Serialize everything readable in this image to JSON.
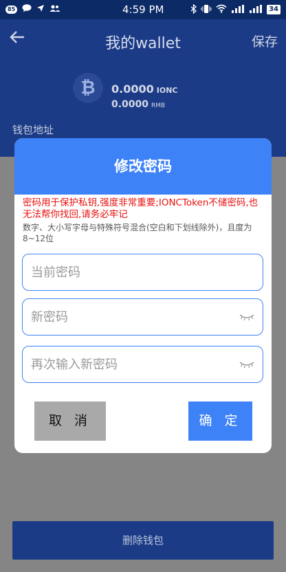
{
  "status_bar": {
    "notif_count": "85",
    "time": "4:59 PM",
    "battery": "34"
  },
  "header": {
    "title": "我的wallet",
    "save_label": "保存"
  },
  "balance": {
    "amount_1": "0.0000",
    "unit_1": "IONC",
    "amount_2": "0.0000",
    "unit_2": "RMB"
  },
  "address_label": "钱包地址",
  "dialog": {
    "title": "修改密码",
    "warning": "密码用于保护私钥,强度非常重要;IONCToken不储密码,也无法帮你找回,请务必牢记",
    "hint": "数字、大小写字母与特殊符号混合(空白和下划线除外)，且度为8~12位",
    "current_password_placeholder": "当前密码",
    "new_password_placeholder": "新密码",
    "confirm_password_placeholder": "再次输入新密码",
    "cancel_label": "取 消",
    "confirm_label": "确 定"
  },
  "delete_label": "删除钱包",
  "icons": {
    "back": "back-arrow-icon",
    "coin": "bitcoin-icon",
    "eye": "eye-closed-icon"
  },
  "colors": {
    "primary": "#3d82f7",
    "warning": "#e8100e",
    "header_bg": "#1c3b86"
  }
}
